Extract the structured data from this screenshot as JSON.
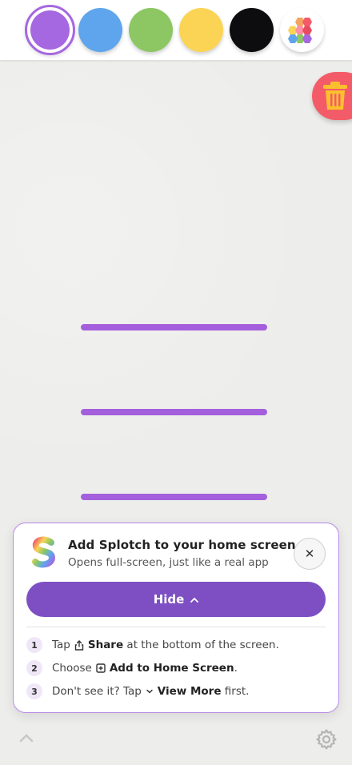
{
  "palette": {
    "colors": [
      {
        "name": "purple",
        "hex": "#a668e0",
        "selected": true
      },
      {
        "name": "blue",
        "hex": "#5ea5ed"
      },
      {
        "name": "green",
        "hex": "#8cc763"
      },
      {
        "name": "yellow",
        "hex": "#fbd455"
      },
      {
        "name": "black",
        "hex": "#0d0d10"
      },
      {
        "name": "multicolor",
        "icon": "hexagon-cluster-icon"
      }
    ]
  },
  "trash": {
    "icon": "trash-icon",
    "color": "#f45b68"
  },
  "drawing": {
    "stroke_color": "#a45fdc",
    "stroke_count": 3
  },
  "install_card": {
    "title": "Add Splotch to your home screen",
    "subtitle": "Opens full-screen, just like a real app",
    "close_label": "✕",
    "hide_label": "Hide",
    "steps": [
      {
        "num": "1",
        "pre": "Tap",
        "strong": "Share",
        "post": "at the bottom of the screen.",
        "icon": "share-icon"
      },
      {
        "num": "2",
        "pre": "Choose",
        "strong": "Add to Home Screen",
        "post": ".",
        "icon": "add-square-icon"
      },
      {
        "num": "3",
        "pre": "Don't see it? Tap",
        "strong": "View More",
        "post": "first.",
        "icon": "chevron-down-icon"
      }
    ]
  },
  "accent": "#7d4fc3"
}
